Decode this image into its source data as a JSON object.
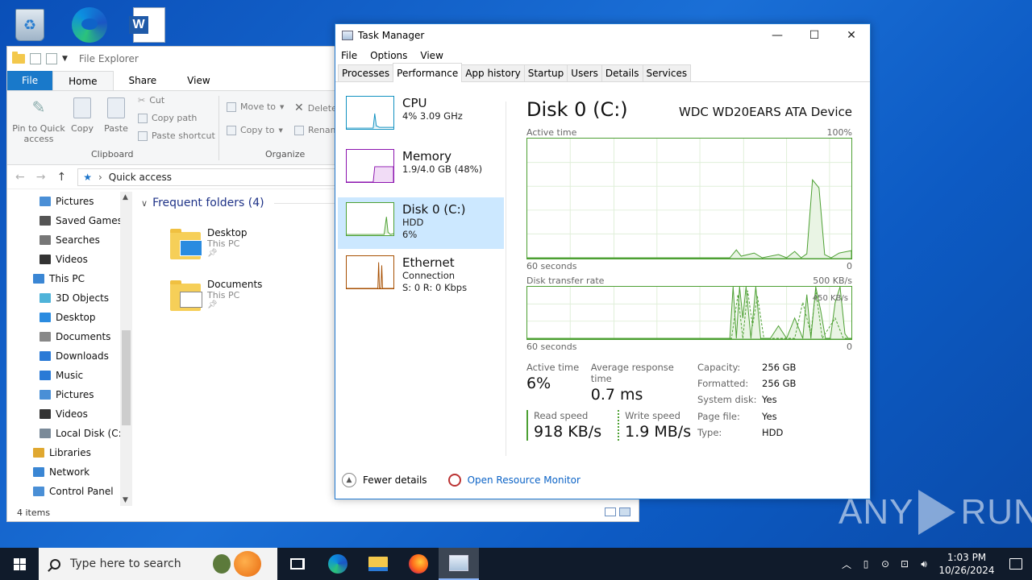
{
  "explorer": {
    "title": "File Explorer",
    "tabs": [
      "File",
      "Home",
      "Share",
      "View"
    ],
    "ribbon": {
      "pin": "Pin to Quick access",
      "copy": "Copy",
      "paste": "Paste",
      "cut": "Cut",
      "copy_path": "Copy path",
      "paste_shortcut": "Paste shortcut",
      "clipboard": "Clipboard",
      "move_to": "Move to",
      "copy_to": "Copy to",
      "delete": "Delete",
      "rename": "Rename",
      "organize": "Organize"
    },
    "address": "Quick access",
    "nav": [
      {
        "label": "Pictures",
        "icon": "pictures-icon",
        "indent": 1
      },
      {
        "label": "Saved Games",
        "icon": "saved-games-icon",
        "indent": 1
      },
      {
        "label": "Searches",
        "icon": "searches-icon",
        "indent": 1
      },
      {
        "label": "Videos",
        "icon": "videos-icon",
        "indent": 1
      },
      {
        "label": "This PC",
        "icon": "this-pc-icon",
        "indent": 0
      },
      {
        "label": "3D Objects",
        "icon": "3d-objects-icon",
        "indent": 1
      },
      {
        "label": "Desktop",
        "icon": "desktop-icon",
        "indent": 1
      },
      {
        "label": "Documents",
        "icon": "documents-icon",
        "indent": 1
      },
      {
        "label": "Downloads",
        "icon": "downloads-icon",
        "indent": 1
      },
      {
        "label": "Music",
        "icon": "music-icon",
        "indent": 1
      },
      {
        "label": "Pictures",
        "icon": "pictures-icon",
        "indent": 1
      },
      {
        "label": "Videos",
        "icon": "videos-icon",
        "indent": 1
      },
      {
        "label": "Local Disk (C:)",
        "icon": "local-disk-icon",
        "indent": 1
      },
      {
        "label": "Libraries",
        "icon": "libraries-icon",
        "indent": 0
      },
      {
        "label": "Network",
        "icon": "network-icon",
        "indent": 0
      },
      {
        "label": "Control Panel",
        "icon": "control-panel-icon",
        "indent": 0
      }
    ],
    "frequent_header": "Frequent folders (4)",
    "folders": [
      {
        "name": "Desktop",
        "location": "This PC"
      },
      {
        "name": "Documents",
        "location": "This PC"
      }
    ],
    "status": "4 items"
  },
  "taskmgr": {
    "title": "Task Manager",
    "menu": [
      "File",
      "Options",
      "View"
    ],
    "tabs": [
      "Processes",
      "Performance",
      "App history",
      "Startup",
      "Users",
      "Details",
      "Services"
    ],
    "active_tab": "Performance",
    "resources": [
      {
        "name": "CPU",
        "line1": "4% 3.09 GHz",
        "line2": "",
        "color": "#1191c1"
      },
      {
        "name": "Memory",
        "line1": "1.9/4.0 GB (48%)",
        "line2": "",
        "color": "#8b12ae"
      },
      {
        "name": "Disk 0 (C:)",
        "line1": "HDD",
        "line2": "6%",
        "color": "#4da033"
      },
      {
        "name": "Ethernet",
        "line1": "Connection",
        "line2": "S: 0 R: 0 Kbps",
        "color": "#a74f01"
      }
    ],
    "disk": {
      "title": "Disk 0 (C:)",
      "device": "WDC WD20EARS ATA Device",
      "active_time_label": "Active time",
      "active_time_max": "100%",
      "seconds_label": "60 seconds",
      "zero": "0",
      "transfer_label": "Disk transfer rate",
      "transfer_max": "500 KB/s",
      "transfer_mid": "450 KB/s",
      "stats": {
        "active_time": {
          "label": "Active time",
          "value": "6%"
        },
        "avg_response": {
          "label": "Average response time",
          "value": "0.7 ms"
        },
        "read_speed": {
          "label": "Read speed",
          "value": "918 KB/s"
        },
        "write_speed": {
          "label": "Write speed",
          "value": "1.9 MB/s"
        }
      },
      "props": [
        {
          "k": "Capacity:",
          "v": "256 GB"
        },
        {
          "k": "Formatted:",
          "v": "256 GB"
        },
        {
          "k": "System disk:",
          "v": "Yes"
        },
        {
          "k": "Page file:",
          "v": "Yes"
        },
        {
          "k": "Type:",
          "v": "HDD"
        }
      ]
    },
    "fewer_details": "Fewer details",
    "open_resource_monitor": "Open Resource Monitor"
  },
  "taskbar": {
    "search_placeholder": "Type here to search",
    "time": "1:03 PM",
    "date": "10/26/2024"
  },
  "watermark": {
    "left": "ANY",
    "right": "RUN"
  }
}
